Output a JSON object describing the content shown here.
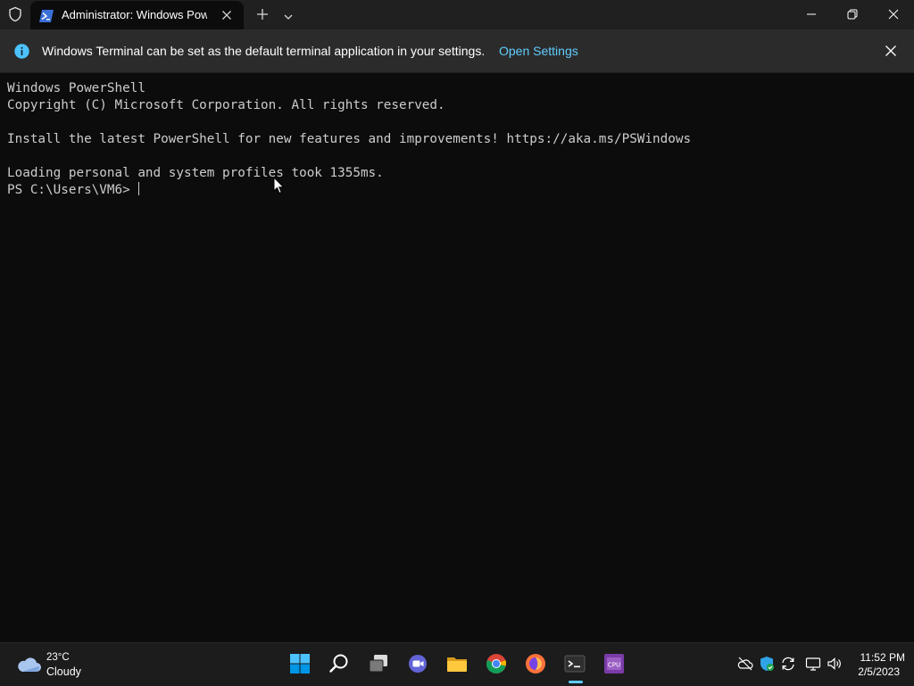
{
  "window": {
    "tab_title": "Administrator: Windows PowerShell",
    "tab_icon": "powershell-icon",
    "controls": [
      "minimize-icon",
      "maximize-icon",
      "close-icon"
    ]
  },
  "infobar": {
    "message": "Windows Terminal can be set as the default terminal application in your settings.",
    "link": "Open Settings"
  },
  "terminal": {
    "lines": [
      "Windows PowerShell",
      "Copyright (C) Microsoft Corporation. All rights reserved.",
      "",
      "Install the latest PowerShell for new features and improvements! https://aka.ms/PSWindows",
      "",
      "Loading personal and system profiles took 1355ms."
    ],
    "prompt": "PS C:\\Users\\VM6> "
  },
  "taskbar": {
    "weather": {
      "temp": "23°C",
      "condition": "Cloudy",
      "icon": "cloud-icon"
    },
    "apps": [
      "start-icon",
      "search-icon",
      "task-view-icon",
      "chat-icon",
      "file-explorer-icon",
      "chrome-icon",
      "firefox-icon",
      "terminal-icon",
      "cpuz-icon"
    ],
    "active_app": "terminal",
    "tray": [
      "no-sync-cloud-icon",
      "security-shield-icon",
      "refresh-icon",
      "network-icon",
      "volume-icon"
    ],
    "clock": {
      "time": "11:52 PM",
      "date": "2/5/2023"
    }
  },
  "colors": {
    "terminal_bg": "#0c0c0c",
    "terminal_fg": "#cccccc",
    "titlebar_bg": "#202020",
    "infobar_bg": "#2b2b2b",
    "link": "#60cdff",
    "taskbar_bg": "#1c1c1c"
  }
}
